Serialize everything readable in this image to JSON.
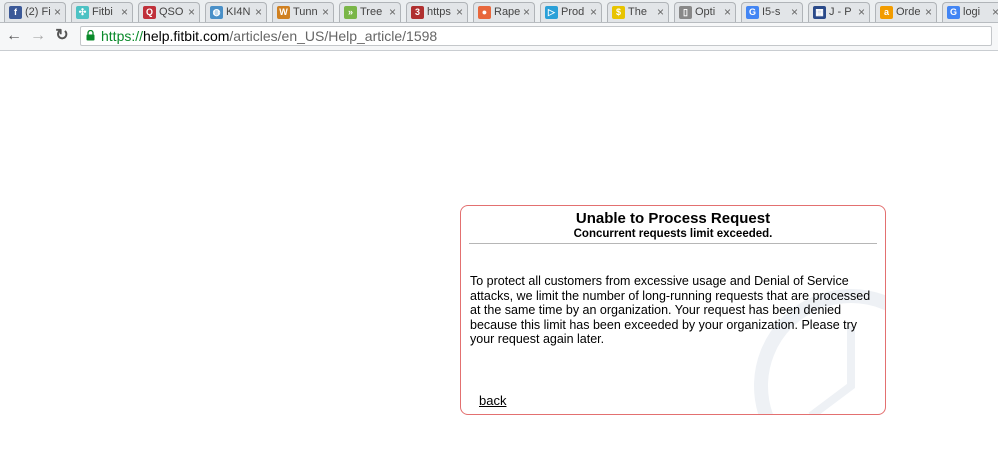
{
  "browser": {
    "tabs": [
      {
        "label": "(2) Fi",
        "icon": "facebook-icon",
        "color": "#3b5998",
        "glyph": "f"
      },
      {
        "label": "Fitbi",
        "icon": "fitbit-icon",
        "color": "#4cc2c4",
        "glyph": "✣"
      },
      {
        "label": "QSO",
        "icon": "qso-icon",
        "color": "#c0303a",
        "glyph": "Q"
      },
      {
        "label": "KI4N",
        "icon": "globe-icon",
        "color": "#4a90c8",
        "glyph": "◍"
      },
      {
        "label": "Tunn",
        "icon": "wa-icon",
        "color": "#d08020",
        "glyph": "W"
      },
      {
        "label": "Tree",
        "icon": "tree-icon",
        "color": "#7ab648",
        "glyph": "»"
      },
      {
        "label": "https",
        "icon": "page-icon",
        "color": "#b03030",
        "glyph": "3"
      },
      {
        "label": "Rape",
        "icon": "rapportive-icon",
        "color": "#e8673c",
        "glyph": "●"
      },
      {
        "label": "Prod",
        "icon": "product-icon",
        "color": "#2aa0d8",
        "glyph": "▷"
      },
      {
        "label": "The",
        "icon": "the-icon",
        "color": "#e8c400",
        "glyph": "$"
      },
      {
        "label": "Opti",
        "icon": "document-icon",
        "color": "#888888",
        "glyph": "▯"
      },
      {
        "label": "I5-s",
        "icon": "google-icon",
        "color": "#4285f4",
        "glyph": "G"
      },
      {
        "label": "J - P",
        "icon": "grid-icon",
        "color": "#2a4a8a",
        "glyph": "▦"
      },
      {
        "label": "Orde",
        "icon": "amazon-icon",
        "color": "#f29c00",
        "glyph": "a"
      },
      {
        "label": "logi",
        "icon": "google-icon",
        "color": "#4285f4",
        "glyph": "G"
      }
    ],
    "close_glyph": "×",
    "back_glyph": "←",
    "forward_glyph": "→",
    "reload_glyph": "↻",
    "url_scheme": "https://",
    "url_host": "help.fitbit.com",
    "url_path": "/articles/en_US/Help_article/1598"
  },
  "error": {
    "title": "Unable to Process Request",
    "subtitle": "Concurrent requests limit exceeded.",
    "body": "To protect all customers from excessive usage and Denial of Service attacks, we limit the number of long-running requests that are processed at the same time by an organization. Your request has been denied because this limit has been exceeded by your organization. Please try your request again later.",
    "back_label": "back"
  }
}
